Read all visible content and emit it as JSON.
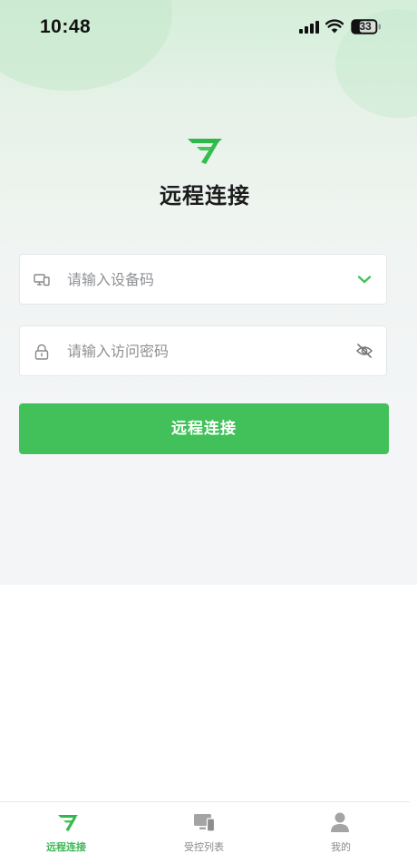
{
  "status_bar": {
    "time": "10:48",
    "battery": "33",
    "icons": [
      "signal-icon",
      "wifi-icon",
      "battery-icon"
    ]
  },
  "header": {
    "logo": "paper-plane-logo-icon",
    "title": "远程连接"
  },
  "form": {
    "device_field": {
      "icon": "devices-icon",
      "placeholder": "请输入设备码",
      "value": "",
      "trailing_icon": "chevron-down-icon"
    },
    "password_field": {
      "icon": "lock-icon",
      "placeholder": "请输入访问密码",
      "value": "",
      "trailing_icon": "eye-off-icon"
    },
    "connect_label": "远程连接"
  },
  "tab_bar": {
    "active_index": 0,
    "tabs": [
      {
        "label": "远程连接",
        "icon": "paper-plane-icon"
      },
      {
        "label": "受控列表",
        "icon": "devices-icon"
      },
      {
        "label": "我的",
        "icon": "user-icon"
      }
    ]
  },
  "colors": {
    "accent": "#42c15a",
    "hero_top": "#d4eed9",
    "hero_bottom": "#f4f5f7",
    "placeholder": "#8e9094",
    "tab_inactive": "#8a8a8a"
  }
}
